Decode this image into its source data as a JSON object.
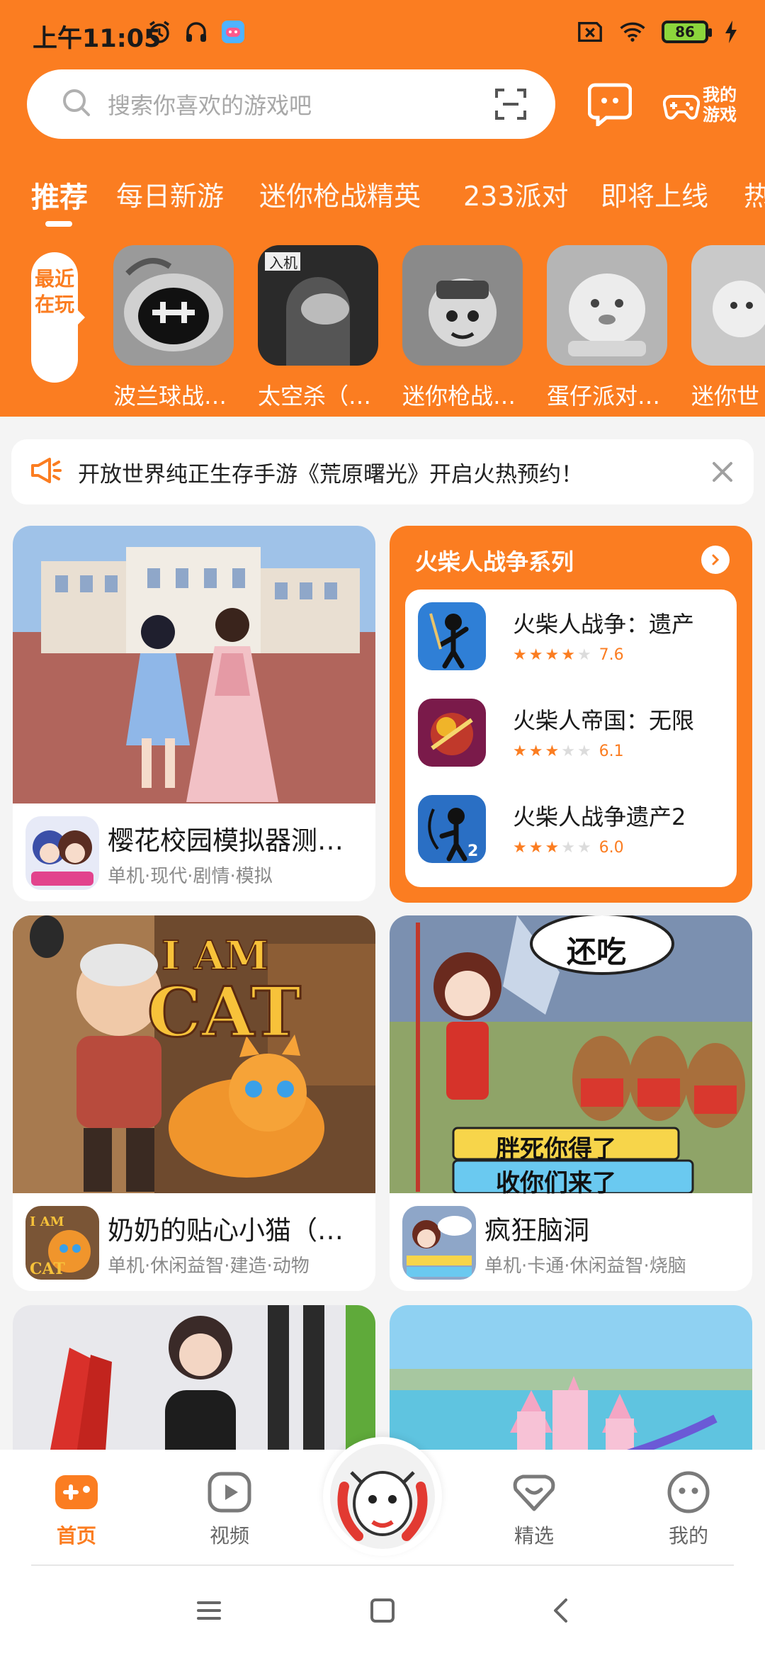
{
  "status_bar": {
    "time": "上午11:05",
    "battery": "86"
  },
  "search": {
    "placeholder": "搜索你喜欢的游戏吧"
  },
  "header": {
    "my_games_line1": "我的",
    "my_games_line2": "游戏"
  },
  "tabs": [
    {
      "label": "推荐",
      "active": true
    },
    {
      "label": "每日新游"
    },
    {
      "label": "迷你枪战精英"
    },
    {
      "label": "233派对"
    },
    {
      "label": "即将上线"
    },
    {
      "label": "热"
    }
  ],
  "recent": {
    "label": "最近在玩",
    "games": [
      {
        "name": "波兰球战…"
      },
      {
        "name": "太空杀（…"
      },
      {
        "name": "迷你枪战…"
      },
      {
        "name": "蛋仔派对…"
      },
      {
        "name": "迷你世"
      }
    ]
  },
  "notice": {
    "text": "开放世界纯正生存手游《荒原曙光》开启火热预约！"
  },
  "cards": [
    {
      "title": "樱花校园模拟器测…",
      "tags": "单机·现代·剧情·模拟"
    },
    {
      "title": "奶奶的贴心小猫（…",
      "tags": "单机·休闲益智·建造·动物",
      "image_text_1": "I AM",
      "image_text_2": "CAT"
    },
    {
      "title": "疯狂脑洞",
      "tags": "单机·卡通·休闲益智·烧脑",
      "image_text_1": "还吃",
      "image_text_2": "胖死你得了",
      "image_text_3": "收你们来了"
    }
  ],
  "series": {
    "title": "火柴人战争系列",
    "items": [
      {
        "name": "火柴人战争：遗产",
        "rating": "7.6",
        "stars": 4
      },
      {
        "name": "火柴人帝国：无限",
        "rating": "6.1",
        "stars": 3
      },
      {
        "name": "火柴人战争遗产2",
        "rating": "6.0",
        "stars": 3
      }
    ]
  },
  "bottom_nav": {
    "home": "首页",
    "video": "视频",
    "featured": "精选",
    "mine": "我的"
  },
  "colors": {
    "accent": "#fb7d21",
    "background": "#f4f4f4"
  }
}
